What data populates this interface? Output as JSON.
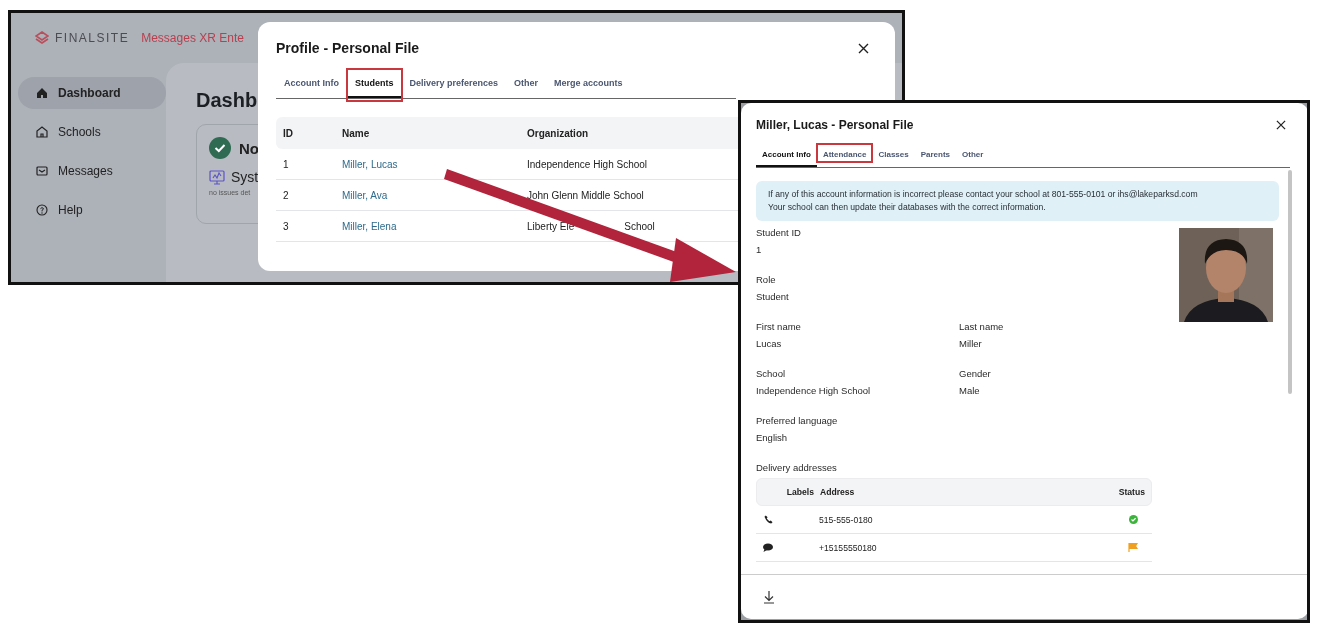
{
  "background_app": {
    "logo": "FINALSITE",
    "product": "Messages XR Ente",
    "sidebar": [
      {
        "label": "Dashboard",
        "selected": true
      },
      {
        "label": "Schools",
        "selected": false
      },
      {
        "label": "Messages",
        "selected": false
      },
      {
        "label": "Help",
        "selected": false
      }
    ],
    "page_title": "Dashb",
    "status_card": {
      "title": "No",
      "item": "Syst",
      "note": "no issues det"
    }
  },
  "profile_dialog": {
    "title": "Profile - Personal File",
    "tabs": [
      {
        "label": "Account Info",
        "selected": false,
        "highlighted": false
      },
      {
        "label": "Students",
        "selected": true,
        "highlighted": true
      },
      {
        "label": "Delivery preferences",
        "selected": false,
        "highlighted": false
      },
      {
        "label": "Other",
        "selected": false,
        "highlighted": false
      },
      {
        "label": "Merge accounts",
        "selected": false,
        "highlighted": false
      }
    ],
    "table": {
      "columns": [
        "ID",
        "Name",
        "Organization"
      ],
      "rows": [
        {
          "id": "1",
          "name": "Miller, Lucas",
          "organization": [
            "Independence High School"
          ]
        },
        {
          "id": "2",
          "name": "Miller, Ava",
          "organization": [
            "John Glenn Middle School"
          ]
        },
        {
          "id": "3",
          "name": "Miller, Elena",
          "organization": [
            "Liberty Ele",
            "School"
          ]
        }
      ]
    }
  },
  "student_dialog": {
    "title": "Miller, Lucas - Personal File",
    "tabs": [
      {
        "label": "Account Info",
        "selected": true,
        "highlighted": false
      },
      {
        "label": "Attendance",
        "selected": false,
        "highlighted": true
      },
      {
        "label": "Classes",
        "selected": false,
        "highlighted": false
      },
      {
        "label": "Parents",
        "selected": false,
        "highlighted": false
      },
      {
        "label": "Other",
        "selected": false,
        "highlighted": false
      }
    ],
    "notice": [
      "If any of this account information is incorrect please contact your school at 801-555-0101 or ihs@lakeparksd.com",
      "Your school can then update their databases with the correct information."
    ],
    "field_rows": [
      {
        "fields": [
          {
            "label": "Student ID",
            "value": "1"
          }
        ]
      },
      {
        "fields": [
          {
            "label": "Role",
            "value": "Student"
          }
        ]
      },
      {
        "fields": [
          {
            "label": "First name",
            "value": "Lucas"
          },
          {
            "label": "Last name",
            "value": "Miller"
          }
        ]
      },
      {
        "fields": [
          {
            "label": "School",
            "value": "Independence High School"
          },
          {
            "label": "Gender",
            "value": "Male"
          }
        ]
      },
      {
        "fields": [
          {
            "label": "Preferred language",
            "value": "English"
          }
        ]
      }
    ],
    "photo": {
      "kind": "picture"
    },
    "delivery": {
      "title": "Delivery addresses",
      "columns": [
        "Labels",
        "Address",
        "Status"
      ],
      "rows": [
        {
          "kind": "phone",
          "address": "515-555-0180",
          "verified": true
        },
        {
          "kind": "sms",
          "address": "+15155550180",
          "verified": false
        }
      ]
    }
  }
}
